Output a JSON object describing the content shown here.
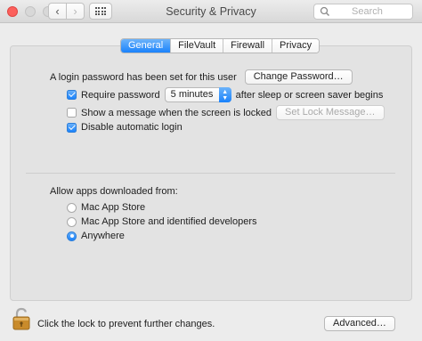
{
  "window": {
    "title": "Security & Privacy"
  },
  "search": {
    "placeholder": "Search"
  },
  "tabs": [
    {
      "label": "General",
      "active": true
    },
    {
      "label": "FileVault",
      "active": false
    },
    {
      "label": "Firewall",
      "active": false
    },
    {
      "label": "Privacy",
      "active": false
    }
  ],
  "general": {
    "password_status": "A login password has been set for this user",
    "change_password_button": "Change Password…",
    "require_password": {
      "label": "Require password",
      "checked": true,
      "select_value": "5 minutes",
      "suffix": "after sleep or screen saver begins"
    },
    "show_message": {
      "label": "Show a message when the screen is locked",
      "checked": false,
      "button": "Set Lock Message…"
    },
    "disable_auto_login": {
      "label": "Disable automatic login",
      "checked": true
    }
  },
  "allow_apps": {
    "heading": "Allow apps downloaded from:",
    "options": [
      {
        "label": "Mac App Store",
        "selected": false
      },
      {
        "label": "Mac App Store and identified developers",
        "selected": false
      },
      {
        "label": "Anywhere",
        "selected": true
      }
    ]
  },
  "footer": {
    "lock_text": "Click the lock to prevent further changes.",
    "advanced_button": "Advanced…"
  },
  "colors": {
    "accent": "#1a82fb",
    "close": "#fc605c"
  },
  "icons": [
    "chevron-left-icon",
    "chevron-right-icon",
    "grid-icon",
    "search-icon",
    "lock-icon"
  ]
}
